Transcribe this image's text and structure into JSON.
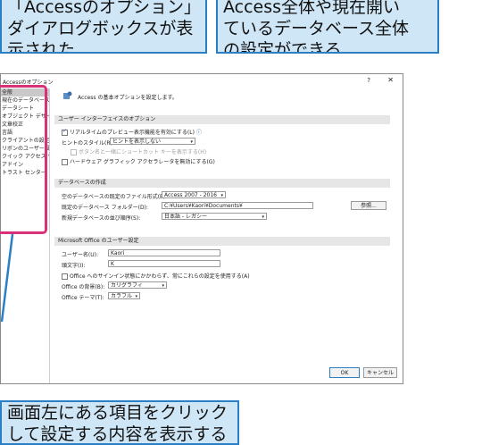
{
  "callouts": {
    "top_left": [
      "「Accessのオプション」",
      "ダイアログボックスが表",
      "示された"
    ],
    "top_right": [
      "Access全体や現在開い",
      "ているデータベース全体",
      "の設定ができる"
    ],
    "bottom": [
      "画面左にある項目をクリック",
      "して設定する内容を表示する"
    ]
  },
  "dialog": {
    "title": "Accessのオプション",
    "help": "?",
    "close": "✕",
    "sidebar": {
      "items": [
        "全般",
        "現在のデータベース",
        "データシート",
        "オブジェクト デザイナー",
        "文章校正",
        "言語",
        "クライアントの設定",
        "リボンのユーザー設定",
        "クイック アクセス ツール バー",
        "アドイン",
        "トラスト センター"
      ],
      "selected_index": 0
    },
    "header_text": "Access の基本オプションを設定します。",
    "ui_section": {
      "title": "ユーザー インターフェイスのオプション",
      "live_preview": "リアルタイムのプレビュー表示機能を有効にする(L)",
      "live_preview_checked": true,
      "tooltip_style_label": "ヒントのスタイル(R):",
      "tooltip_style_value": "ヒントを表示しない",
      "shortcut_keys": "ボタン名と一緒にショートカット キーを表示する(H)",
      "hw_accel": "ハードウェア グラフィック アクセラレータを無効にする(G)",
      "hw_accel_checked": false
    },
    "db_section": {
      "title": "データベースの作成",
      "file_format_label": "空のデータベースの既定のファイル形式(E):",
      "file_format_value": "Access 2007 - 2016",
      "folder_label": "既定のデータベース フォルダー(D):",
      "folder_value": "C:¥Users¥Kaori¥Documents¥",
      "browse": "参照...",
      "sort_label": "新規データベースの並び順序(S):",
      "sort_value": "日本語 - レガシー"
    },
    "user_section": {
      "title": "Microsoft Office のユーザー設定",
      "username_label": "ユーザー名(U):",
      "username_value": "Kaori",
      "initials_label": "頭文字(I):",
      "initials_value": "K",
      "always_use": "Office へのサインイン状態にかかわらず、常にこれらの設定を使用する(A)",
      "background_label": "Office の背景(B):",
      "background_value": "カリグラフィ",
      "theme_label": "Office テーマ(T):",
      "theme_value": "カラフル"
    },
    "ok": "OK",
    "cancel": "キャンセル"
  },
  "colors": {
    "callout_bg": "#cfe6f6",
    "callout_border": "#2b7fc4",
    "highlight": "#d9307a"
  }
}
